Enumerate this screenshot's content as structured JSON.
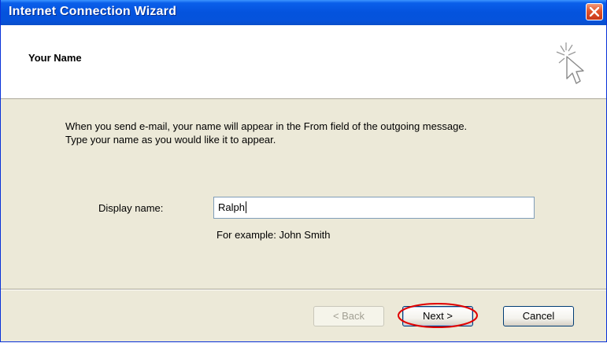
{
  "window": {
    "title": "Internet Connection Wizard"
  },
  "header": {
    "title": "Your Name",
    "icon": "wizard-sparkle-cursor-icon"
  },
  "body": {
    "instructions_line1": "When you send e-mail, your name will appear in the From field of the outgoing message.",
    "instructions_line2": "Type your name as you would like it to appear.",
    "display_name_label": "Display name:",
    "display_name_value": "Ralph",
    "example_text": "For example: John Smith"
  },
  "buttons": {
    "back_label": "< Back",
    "next_label": "Next >",
    "cancel_label": "Cancel"
  },
  "colors": {
    "titlebar": "#0453dd",
    "dialog_background": "#ece9d8",
    "annotation": "#e00000"
  }
}
